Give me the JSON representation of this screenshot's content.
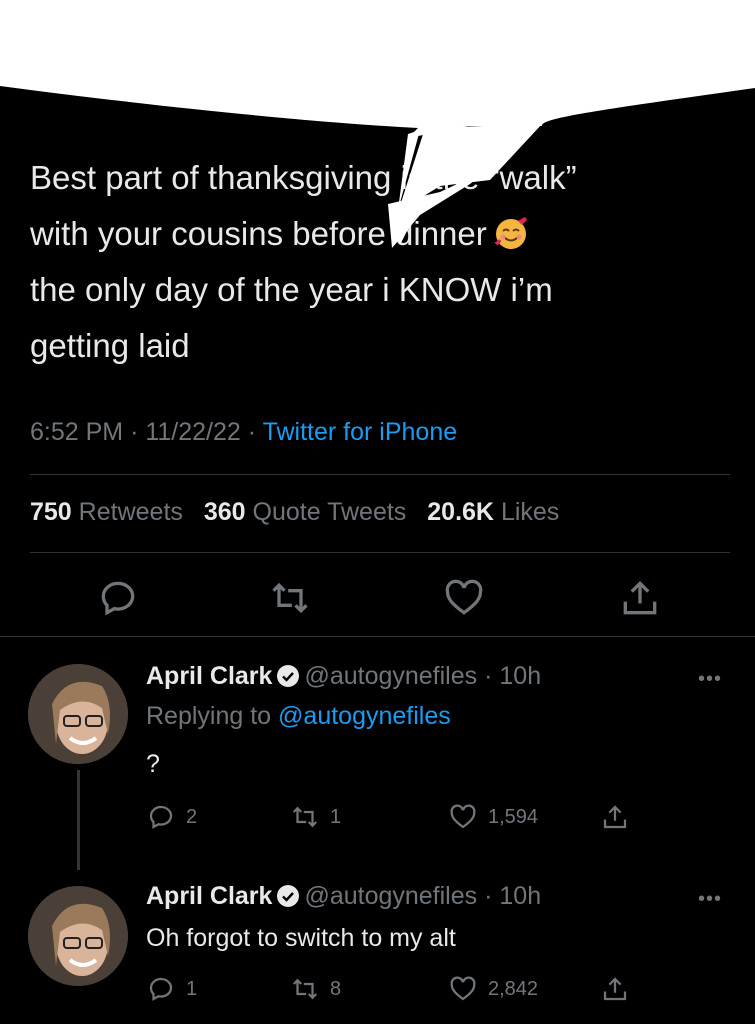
{
  "tweet": {
    "text_lines": [
      "Best part of thanksgiving is the “walk”",
      "with your cousins before dinner",
      "the only day of the year i KNOW i’m",
      "getting laid"
    ],
    "time": "6:52 PM",
    "date": "11/22/22",
    "sep": "·",
    "source": "Twitter for iPhone",
    "retweets_count": "750",
    "retweets_label": "Retweets",
    "quotes_count": "360",
    "quotes_label": "Quote Tweets",
    "likes_count": "20.6K",
    "likes_label": "Likes"
  },
  "replies": [
    {
      "name": "April Clark",
      "handle": "@autogynefiles",
      "time": "10h",
      "replying_prefix": "Replying to",
      "replying_handle": "@autogynefiles",
      "text": "?",
      "reply_count": "2",
      "retweet_count": "1",
      "like_count": "1,594"
    },
    {
      "name": "April Clark",
      "handle": "@autogynefiles",
      "time": "10h",
      "text": "Oh forgot to switch to my alt",
      "reply_count": "1",
      "retweet_count": "8",
      "like_count": "2,842"
    }
  ],
  "more_label": "•••",
  "colors": {
    "background": "#000000",
    "text": "#e7e9ea",
    "muted": "#71767b",
    "accent": "#1d9bf0",
    "bubble": "#ffffff"
  },
  "icons": [
    "reply-icon",
    "retweet-icon",
    "like-icon",
    "share-icon",
    "verified-badge-icon",
    "smiling-face-with-hearts-emoji"
  ]
}
